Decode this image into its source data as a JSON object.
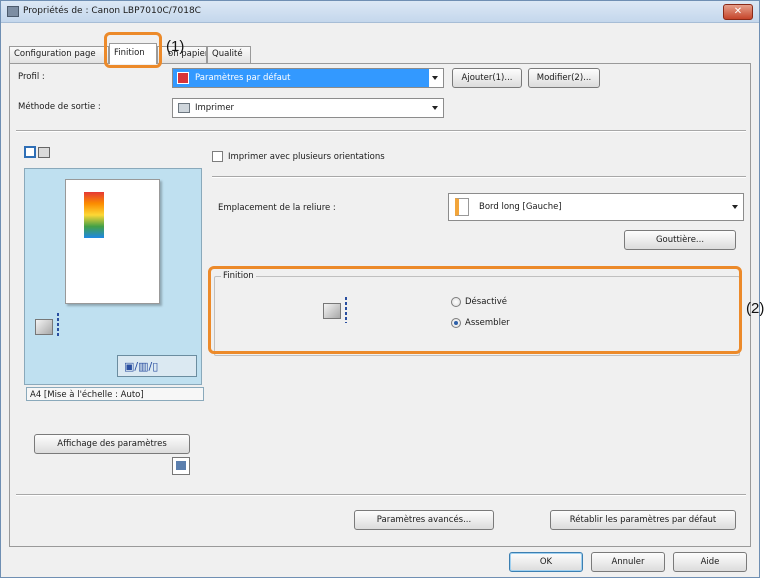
{
  "window": {
    "title": "Propriétés de : Canon LBP7010C/7018C",
    "close_glyph": "✕"
  },
  "tabs": [
    {
      "label": "Configuration page"
    },
    {
      "label": "Finition"
    },
    {
      "label": "on papier"
    },
    {
      "label": "Qualité"
    }
  ],
  "profile": {
    "label": "Profil :",
    "value": "Paramètres par défaut",
    "add_button": "Ajouter(1)...",
    "modify_button": "Modifier(2)..."
  },
  "output": {
    "label": "Méthode de sortie :",
    "value": "Imprimer"
  },
  "preview": {
    "caption": "A4 [Mise à l'échelle : Auto]",
    "settings_button": "Affichage des paramètres"
  },
  "finishing": {
    "multi_orientation_label": "Imprimer avec plusieurs orientations",
    "binding_label": "Emplacement de la reliure :",
    "binding_value": "Bord long [Gauche]",
    "gutter_button": "Gouttière...",
    "group_title": "Finition",
    "option_off": "Désactivé",
    "option_collate": "Assembler",
    "selected_option": "Assembler"
  },
  "bottom": {
    "advanced_button": "Paramètres avancés...",
    "reset_button": "Rétablir les paramètres par défaut",
    "ok_button": "OK",
    "cancel_button": "Annuler",
    "help_button": "Aide"
  },
  "annotations": {
    "callout_1": "(1)",
    "callout_2": "(2)",
    "highlight_color": "#ec8a2a"
  },
  "colors": {
    "selection": "#3399ff",
    "preview_bg": "#bfe0f0"
  }
}
